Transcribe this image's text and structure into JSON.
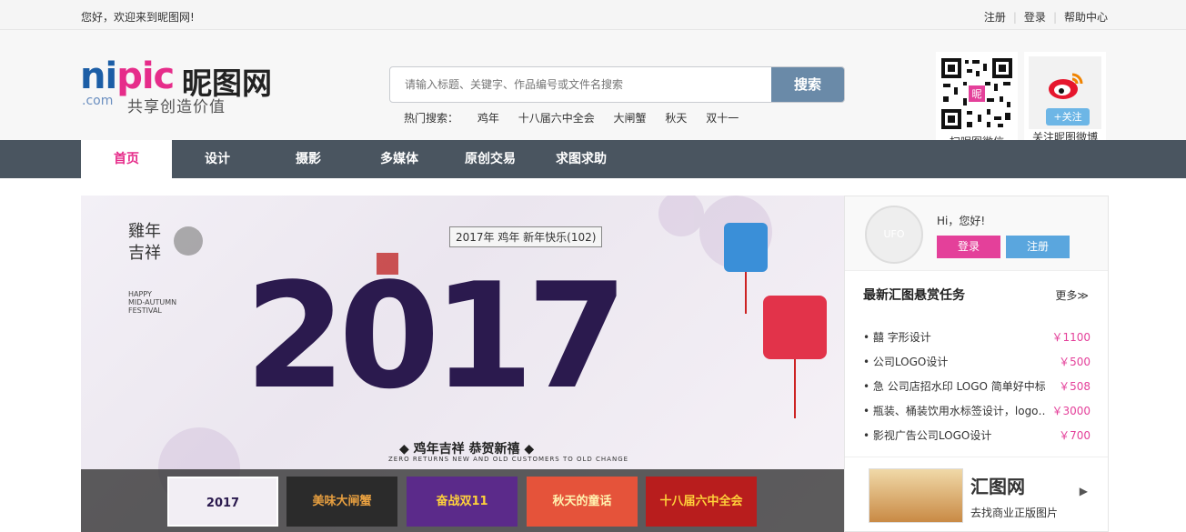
{
  "topbar": {
    "welcome": "您好，欢迎来到昵图网!",
    "links": [
      "注册",
      "登录",
      "帮助中心"
    ]
  },
  "logo": {
    "brand_n": "ni",
    "brand_p": "pic",
    "brand_cn": "昵图网",
    "com": ".com",
    "slogan": "共享创造价值"
  },
  "search": {
    "placeholder": "请输入标题、关键字、作品编号或文件名搜索",
    "button": "搜索",
    "hot_label": "热门搜索：",
    "hot": [
      "鸡年",
      "十八届六中全会",
      "大闸蟹",
      "秋天",
      "双十一"
    ]
  },
  "qr": {
    "caption": "扫昵图微信"
  },
  "weibo": {
    "caption": "关注昵图微博",
    "follow": "+关注"
  },
  "nav": {
    "items": [
      "首页",
      "设计",
      "摄影",
      "多媒体",
      "原创交易",
      "求图求助"
    ],
    "active": 0
  },
  "banner": {
    "title": "2017年 鸡年 新年快乐(102)",
    "big_text": "2017",
    "left_title": "雞年\n吉祥",
    "left_english": "HAPPY\nMID-AUTUMN\nFESTIVAL",
    "slogan": "◆ 鸡年吉祥 恭贺新禧 ◆",
    "sub": "ZERO RETURNS NEW AND OLD CUSTOMERS TO OLD CHANGE",
    "thumbs": [
      {
        "label": "2017",
        "color": "#f2eef4",
        "text_color": "#2b1a4e"
      },
      {
        "label": "美味大闸蟹",
        "color": "#2b2b2b",
        "text_color": "#e8a040"
      },
      {
        "label": "奋战双11",
        "color": "#5b2a8a",
        "text_color": "#ffd23a"
      },
      {
        "label": "秋天的童话",
        "color": "#e5533a",
        "text_color": "#fff3b0"
      },
      {
        "label": "十八届六中全会",
        "color": "#b81d1d",
        "text_color": "#ffd23a"
      }
    ]
  },
  "user": {
    "avatar_text": "UFO",
    "greeting": "Hi，您好!",
    "login": "登录",
    "register": "注册"
  },
  "tasks": {
    "heading": "最新汇图悬赏任务",
    "more": "更多≫",
    "items": [
      {
        "title": "• 囍 字形设计",
        "price": "￥1100"
      },
      {
        "title": "• 公司LOGO设计",
        "price": "￥500"
      },
      {
        "title": "• 急 公司店招水印 LOGO 简单好中标",
        "price": "￥508"
      },
      {
        "title": "• 瓶装、桶装饮用水标签设计，logo…",
        "price": "￥3000"
      },
      {
        "title": "• 影视广告公司LOGO设计",
        "price": "￥700"
      }
    ]
  },
  "ad": {
    "logo": "汇图网",
    "caption": "去找商业正版图片",
    "arrow": "▶"
  }
}
